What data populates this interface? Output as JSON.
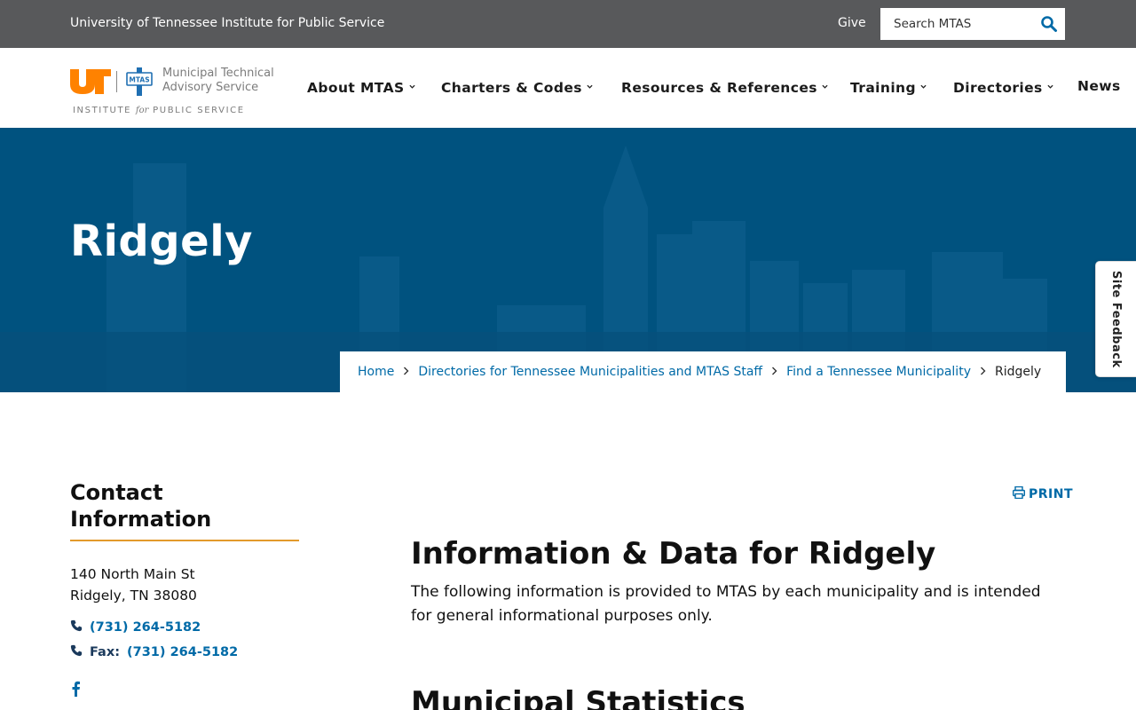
{
  "topbar": {
    "org": "University of Tennessee Institute for Public Service",
    "give": "Give",
    "search_placeholder": "Search MTAS"
  },
  "logo": {
    "ut_mark": "UT",
    "seal_text": "MTAS",
    "name_line1": "Municipal Technical",
    "name_line2": "Advisory Service",
    "ips_part1": "INSTITUTE",
    "ips_for": "for",
    "ips_part2": "PUBLIC SERVICE"
  },
  "nav": {
    "items": [
      {
        "label": "About MTAS"
      },
      {
        "label": "Charters & Codes"
      },
      {
        "label": "Resources & References"
      },
      {
        "label": "Training"
      },
      {
        "label": "Directories"
      },
      {
        "label": "News"
      }
    ]
  },
  "hero": {
    "title": "Ridgely"
  },
  "breadcrumb": {
    "items": [
      {
        "label": "Home"
      },
      {
        "label": "Directories for Tennessee Municipalities and MTAS Staff"
      },
      {
        "label": "Find a Tennessee Municipality"
      }
    ],
    "current": "Ridgely"
  },
  "feedback": {
    "label": "Site Feedback"
  },
  "contact": {
    "heading": "Contact Information",
    "address_line1": "140 North Main St",
    "address_line2": "Ridgely, TN 38080",
    "phone": "(731) 264-5182",
    "fax_label": "Fax:",
    "fax": "(731) 264-5182"
  },
  "content": {
    "print_label": "PRINT",
    "heading": "Information & Data for Ridgely",
    "intro": "The following information is provided to MTAS by each municipality and is intended for general informational purposes only.",
    "stats_heading": "Municipal Statistics"
  },
  "colors": {
    "topbar": "#58595b",
    "hero": "#00527f",
    "link": "#006aa7",
    "accent_orange": "#e39a2c",
    "ut_orange": "#ff8200"
  }
}
